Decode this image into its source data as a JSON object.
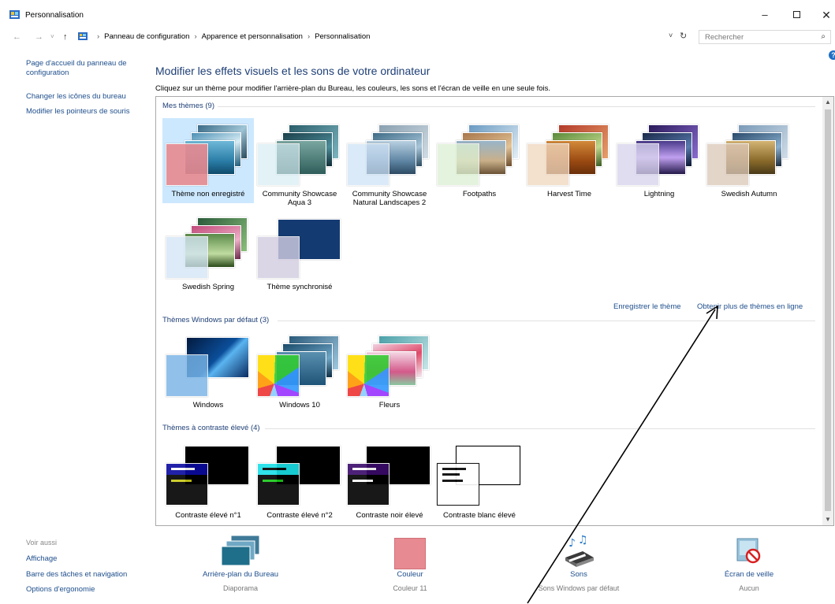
{
  "window": {
    "title": "Personnalisation",
    "min_icon": "–",
    "close_icon": "✕"
  },
  "nav": {
    "back": "←",
    "forward": "→",
    "recent": "˅",
    "up": "↑",
    "breadcrumbs": [
      "Panneau de configuration",
      "Apparence et personnalisation",
      "Personnalisation"
    ],
    "crumb_sep": "›",
    "dropdown": "˅",
    "refresh": "↻",
    "search_placeholder": "Rechercher",
    "search_icon": "⌕"
  },
  "sidebar": {
    "home": "Page d'accueil du panneau de configuration",
    "change_icons": "Changer les icônes du bureau",
    "change_pointers": "Modifier les pointeurs de souris",
    "see_also_header": "Voir aussi",
    "see_also": [
      "Affichage",
      "Barre des tâches et navigation",
      "Options d'ergonomie"
    ]
  },
  "main": {
    "title": "Modifier les effets visuels et les sons de votre ordinateur",
    "subtitle": "Cliquez sur un thème pour modifier l'arrière-plan du Bureau, les couleurs, les sons et l'écran de veille en une seule fois.",
    "help": "?"
  },
  "sections": {
    "my_themes": "Mes thèmes (9)",
    "default_themes": "Thèmes Windows par défaut (3)",
    "contrast_themes": "Thèmes à contraste élevé (4)"
  },
  "my_themes": [
    {
      "label": "Thème non enregistré",
      "selected": true
    },
    {
      "label": "Community Showcase Aqua 3"
    },
    {
      "label": "Community Showcase Natural Landscapes 2"
    },
    {
      "label": "Footpaths"
    },
    {
      "label": "Harvest Time"
    },
    {
      "label": "Lightning"
    },
    {
      "label": "Swedish Autumn"
    },
    {
      "label": "Swedish Spring"
    },
    {
      "label": "Thème synchronisé"
    }
  ],
  "links": {
    "save_theme": "Enregistrer le thème",
    "more_online": "Obtenir plus de thèmes en ligne"
  },
  "default_themes": [
    {
      "label": "Windows"
    },
    {
      "label": "Windows 10"
    },
    {
      "label": "Fleurs"
    }
  ],
  "contrast_themes": [
    {
      "label": "Contraste élevé n°1"
    },
    {
      "label": "Contraste élevé n°2"
    },
    {
      "label": "Contraste noir élevé"
    },
    {
      "label": "Contraste blanc élevé"
    }
  ],
  "bottom": {
    "background": {
      "label": "Arrière-plan du Bureau",
      "value": "Diaporama"
    },
    "color": {
      "label": "Couleur",
      "value": "Couleur 11"
    },
    "sounds": {
      "label": "Sons",
      "value": "Sons Windows par défaut"
    },
    "screensaver": {
      "label": "Écran de veille",
      "value": "Aucun"
    }
  },
  "colors": {
    "link": "#1e4e8c",
    "heading": "#1e3f76",
    "selected": "#cce8ff",
    "accent_color_tile": "#e88a91"
  }
}
